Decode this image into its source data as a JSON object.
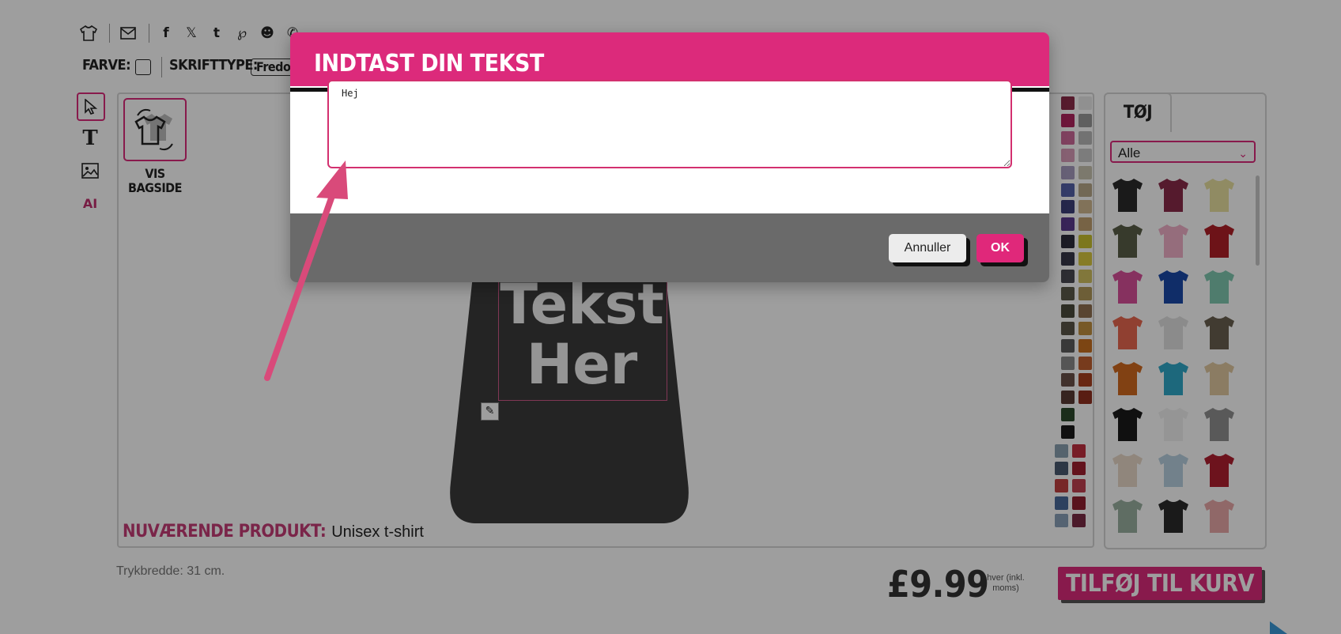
{
  "toolbar": {
    "color_label": "FARVE:",
    "font_label": "SKRIFTTYPE:",
    "font_value": "Fredo"
  },
  "designer": {
    "back_label_1": "VIS",
    "back_label_2": "BAGSIDE",
    "design_text_line1": "Tekst",
    "design_text_line2": "Her",
    "current_product_label": "NUVÆRENDE PRODUKT:",
    "current_product_value": "Unisex t-shirt",
    "print_width": "Trykbredde: 31 cm."
  },
  "panel": {
    "tab_label": "TØJ",
    "category_select": "Alle"
  },
  "purchase": {
    "price": "£9.99",
    "price_note_1": "hver (inkl.",
    "price_note_2": "moms)",
    "add_to_cart": "TILFØJ TIL KURV"
  },
  "modal": {
    "title": "INDTAST DIN TEKST",
    "text_value": "Hej",
    "cancel_label": "Annuller",
    "ok_label": "OK"
  },
  "colors": {
    "accent": "#dc2a7b",
    "arrow": "#d94a7a"
  }
}
